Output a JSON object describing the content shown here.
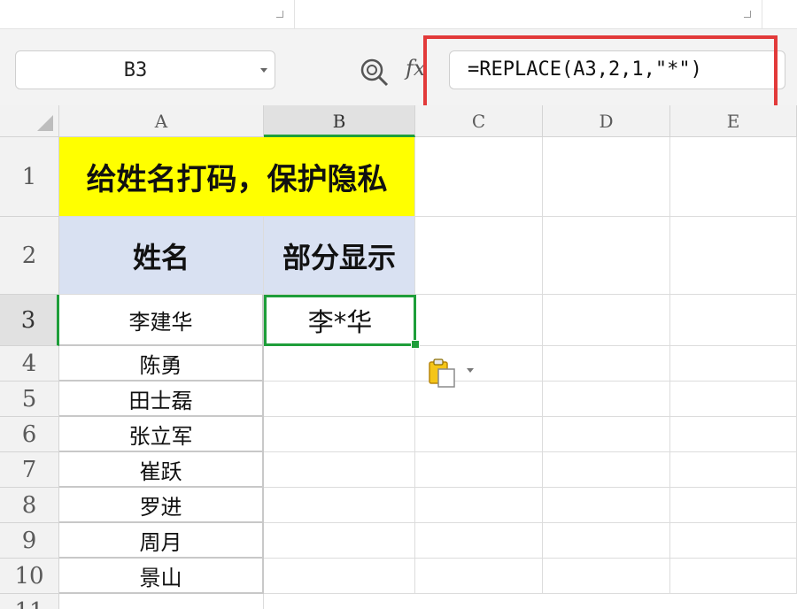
{
  "formula_bar": {
    "name_box": "B3",
    "fx_label": "fx",
    "formula": "=REPLACE(A3,2,1,\"*\")"
  },
  "columns": [
    "A",
    "B",
    "C",
    "D",
    "E"
  ],
  "rows": [
    "1",
    "2",
    "3",
    "4",
    "5",
    "6",
    "7",
    "8",
    "9",
    "10",
    "11"
  ],
  "sheet": {
    "title": "给姓名打码，保护隐私",
    "header_a": "姓名",
    "header_b": "部分显示",
    "names": [
      "李建华",
      "陈勇",
      "田士磊",
      "张立军",
      "崔跃",
      "罗进",
      "周月",
      "景山"
    ],
    "b3_result": "李*华"
  },
  "colors": {
    "title_fill": "#ffff00",
    "header_fill": "#d9e1f2",
    "selection": "#1e9e3a",
    "highlight_frame": "#e23a3a"
  },
  "icons": [
    "zoom-icon",
    "paste-options-icon",
    "dropdown-arrow-icon"
  ]
}
